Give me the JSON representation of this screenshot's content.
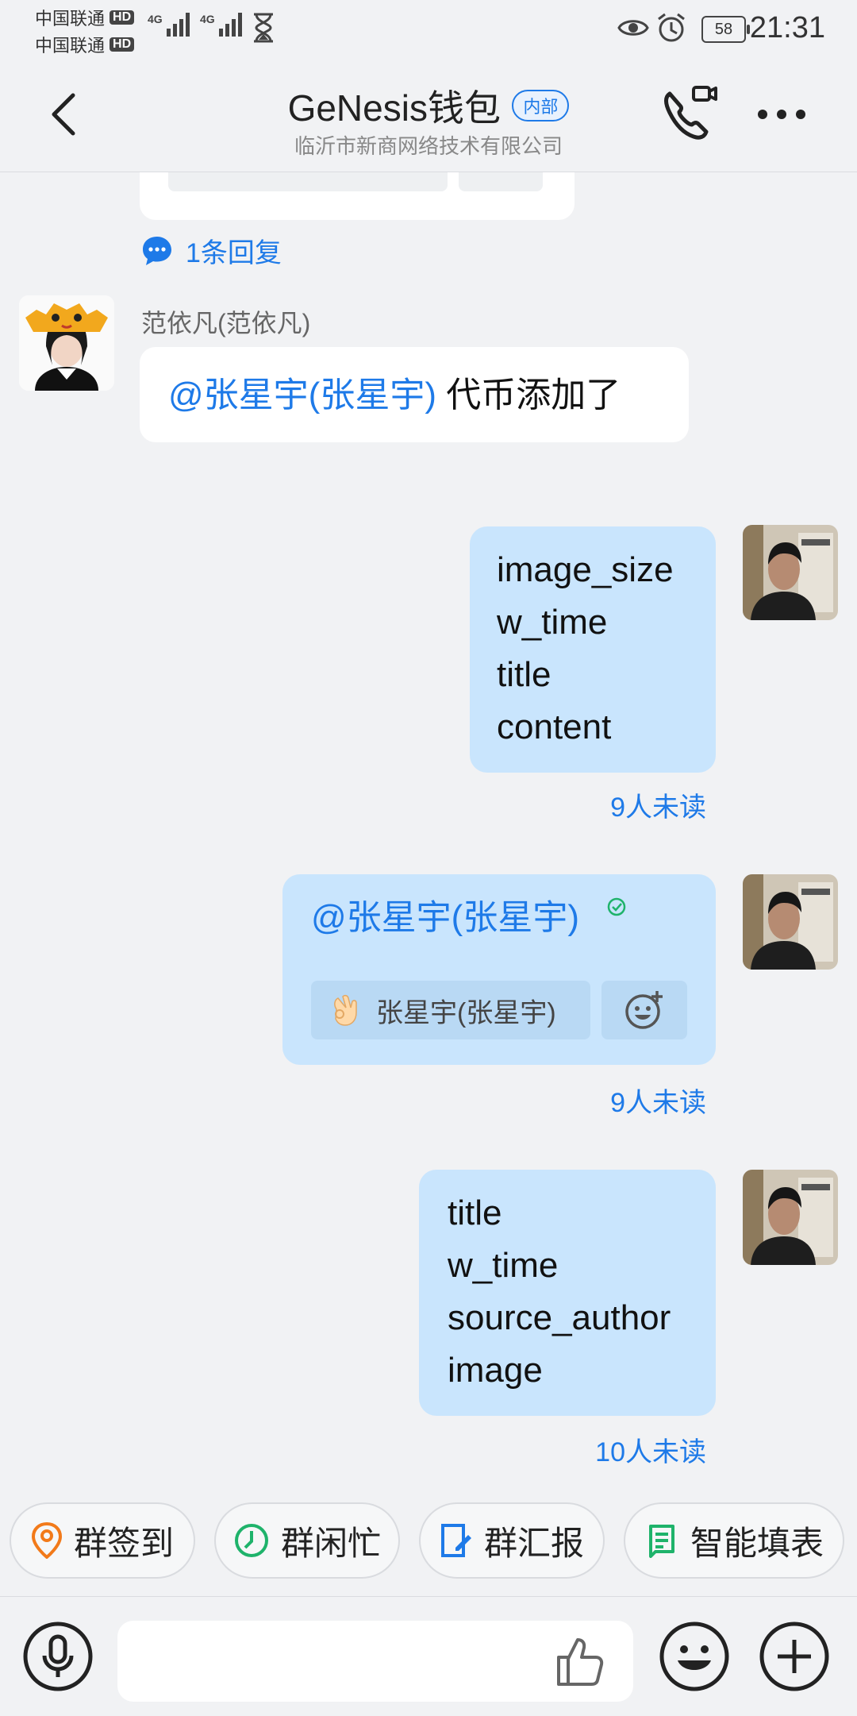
{
  "status": {
    "carrier1": "中国联通",
    "carrier2": "中国联通",
    "hd": "HD",
    "net": "4G",
    "battery": "58",
    "time": "21:31"
  },
  "header": {
    "title": "GeNesis钱包",
    "badge": "内部",
    "subtitle": "临沂市新商网络技术有限公司"
  },
  "thread": {
    "reply_count": "1条回复"
  },
  "messages": [
    {
      "sender": "范依凡(范依凡)",
      "mention": "@张星宇(张星宇)",
      "text": " 代币添加了"
    },
    {
      "lines": [
        "image_size",
        "w_time",
        "title",
        "content"
      ],
      "unread": "9人未读"
    },
    {
      "mention": "@张星宇(张星宇)",
      "reaction_user": "张星宇(张星宇)",
      "unread": "9人未读"
    },
    {
      "lines": [
        "title",
        "w_time",
        "source_author",
        "image"
      ],
      "unread": "10人未读"
    }
  ],
  "quick_actions": [
    "群签到",
    "群闲忙",
    "群汇报",
    "智能填表"
  ],
  "colors": {
    "accent": "#1E7AE8",
    "bubble_self": "#C9E5FD",
    "background": "#F1F2F4"
  }
}
